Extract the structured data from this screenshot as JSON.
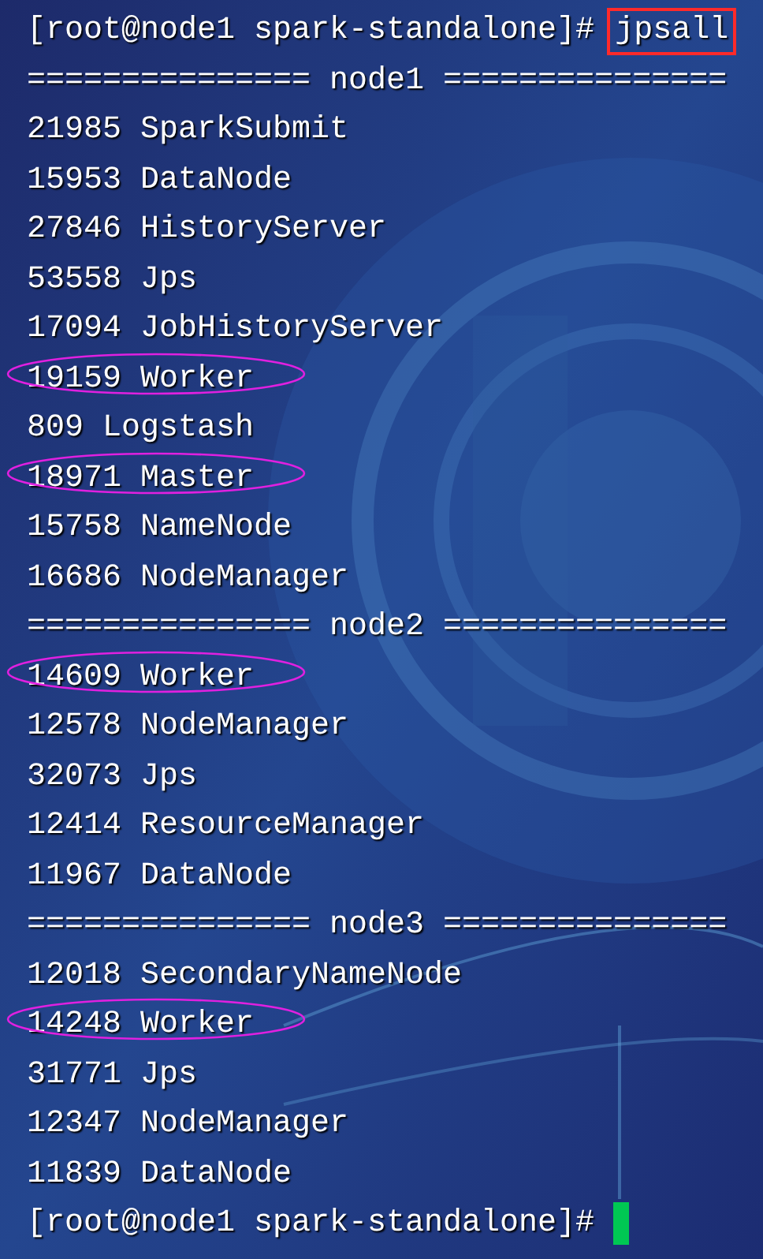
{
  "terminal": {
    "lines": [
      {
        "kind": "prompt",
        "prompt": "[root@node1 spark-standalone]#",
        "command": "jpsall",
        "boxed": true
      },
      {
        "kind": "separator",
        "text": "=============== node1 ==============="
      },
      {
        "kind": "process",
        "text": "21985 SparkSubmit",
        "circled": false
      },
      {
        "kind": "process",
        "text": "15953 DataNode",
        "circled": false
      },
      {
        "kind": "process",
        "text": "27846 HistoryServer",
        "circled": false
      },
      {
        "kind": "process",
        "text": "53558 Jps",
        "circled": false
      },
      {
        "kind": "process",
        "text": "17094 JobHistoryServer",
        "circled": false
      },
      {
        "kind": "process",
        "text": "19159 Worker",
        "circled": true
      },
      {
        "kind": "process",
        "text": "809 Logstash",
        "circled": false
      },
      {
        "kind": "process",
        "text": "18971 Master",
        "circled": true
      },
      {
        "kind": "process",
        "text": "15758 NameNode",
        "circled": false
      },
      {
        "kind": "process",
        "text": "16686 NodeManager",
        "circled": false
      },
      {
        "kind": "separator",
        "text": "=============== node2 ==============="
      },
      {
        "kind": "process",
        "text": "14609 Worker",
        "circled": true
      },
      {
        "kind": "process",
        "text": "12578 NodeManager",
        "circled": false
      },
      {
        "kind": "process",
        "text": "32073 Jps",
        "circled": false
      },
      {
        "kind": "process",
        "text": "12414 ResourceManager",
        "circled": false
      },
      {
        "kind": "process",
        "text": "11967 DataNode",
        "circled": false
      },
      {
        "kind": "separator",
        "text": "=============== node3 ==============="
      },
      {
        "kind": "process",
        "text": "12018 SecondaryNameNode",
        "circled": false
      },
      {
        "kind": "process",
        "text": "14248 Worker",
        "circled": true
      },
      {
        "kind": "process",
        "text": "31771 Jps",
        "circled": false
      },
      {
        "kind": "process",
        "text": "12347 NodeManager",
        "circled": false
      },
      {
        "kind": "process",
        "text": "11839 DataNode",
        "circled": false
      },
      {
        "kind": "prompt",
        "prompt": "[root@node1 spark-standalone]#",
        "cursor": true
      }
    ]
  }
}
